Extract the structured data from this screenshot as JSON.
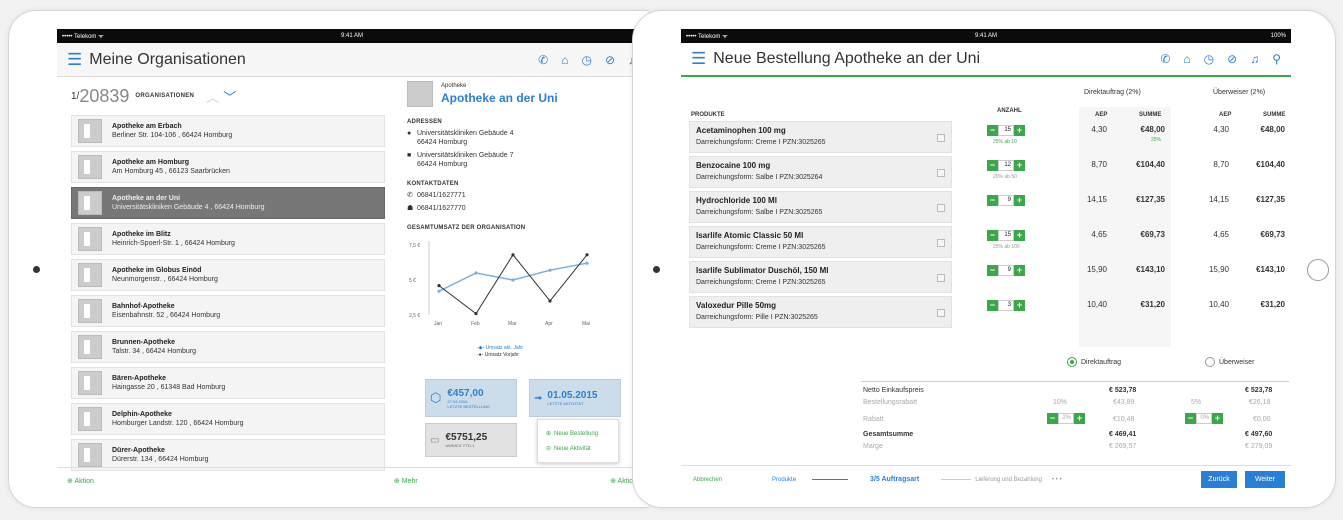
{
  "left": {
    "status": {
      "carrier": "••••• Telekom ᯤ",
      "time": "9:41 AM"
    },
    "nav": {
      "menu_icon": "hamburger-icon",
      "title": "Meine Organisationen"
    },
    "org_header": {
      "count_prefix": "1/",
      "count": "20839",
      "label": "ORGANISATIONEN"
    },
    "organisations": [
      {
        "name": "Apotheke am Erbach",
        "address": "Berliner Str. 104-106 , 66424 Homburg"
      },
      {
        "name": "Apotheke am Homburg",
        "address": "Am Homburg 45 , 66123 Saarbrücken"
      },
      {
        "name": "Apotheke an der Uni",
        "address": "Universitätskliniken Gebäude 4 , 66424 Homburg"
      },
      {
        "name": "Apotheke im Blitz",
        "address": "Heinrich-Spoerl-Str. 1 , 66424 Homburg"
      },
      {
        "name": "Apotheke im Globus Einöd",
        "address": "Neunmorgenstr. , 66424 Homburg"
      },
      {
        "name": "Bahnhof-Apotheke",
        "address": "Eisenbahnstr. 52 , 66424 Homburg"
      },
      {
        "name": "Brunnen-Apotheke",
        "address": "Talstr. 34 , 66424 Homburg"
      },
      {
        "name": "Bären-Apotheke",
        "address": "Haingasse 20 , 61348 Bad Homburg"
      },
      {
        "name": "Delphin-Apotheke",
        "address": "Homburger Landstr. 120 , 66424 Homburg"
      },
      {
        "name": "Dürer-Apotheke",
        "address": "Dürerstr. 134 , 66424 Homburg"
      }
    ],
    "detail": {
      "kind": "Apotheke",
      "name": "Apotheke an der Uni",
      "addresses_label": "ADRESSEN",
      "address1": "Universitätskliniken Gebäude 4",
      "address1b": "66424 Homburg",
      "address2": "Universitätskliniken Gebäude 7",
      "address2b": "66424 Homburg",
      "contact_label": "KONTAKTDATEN",
      "phone": "06841/1627771",
      "fax": "06841/1627770",
      "revenue_label": "GESAMTUMSATZ DER ORGANISATION"
    },
    "tiles": {
      "t1_value": "€457,00",
      "t1_date": "27.04.2015",
      "t1_label": "LETZTE BESTELLUNG",
      "t2_value": "01.05.2015",
      "t2_label": "LETZTE AKTIVITÄT",
      "t3_value": "€5751,25",
      "t3_label": "UMSATZ YTD-1"
    },
    "popup": {
      "item1": "Neue Bestellung",
      "item2": "Neue Aktivität"
    },
    "footer": {
      "action": "Aktion",
      "more": "Mehr",
      "action2": "Aktion"
    }
  },
  "chart_data": {
    "type": "line",
    "categories": [
      "Jan",
      "Feb",
      "Mar",
      "Apr",
      "Mai"
    ],
    "series": [
      {
        "name": "Umsatz akt. Jahr",
        "values": [
          4.2,
          5.5,
          5.0,
          5.7,
          6.2
        ],
        "color": "#7aaee0"
      },
      {
        "name": "Umsatz Vorjahr",
        "values": [
          4.6,
          2.6,
          6.8,
          3.5,
          6.8
        ],
        "color": "#333333"
      }
    ],
    "yticks": [
      "7,5 €",
      "5 €",
      "2,5 €"
    ],
    "ylim": [
      2.5,
      7.5
    ]
  },
  "right": {
    "status": {
      "carrier": "••••• Telekom ᯤ",
      "time": "9:41 AM",
      "battery": "100%"
    },
    "nav": {
      "menu_icon": "hamburger-icon",
      "title": "Neue Bestellung Apotheke an der Uni"
    },
    "headers": {
      "direct": "Direktauftrag (2%)",
      "transfer": "Überweiser (2%)",
      "products": "PRODUKTE",
      "qty": "ANZAHL",
      "aep": "AEP",
      "sum": "SUMME"
    },
    "products": [
      {
        "name": "Acetaminophen 100 mg",
        "desc": "Darreichungsform: Creme I PZN:3025265",
        "qty": "15",
        "note": "25% ab 10",
        "aep": "4,30",
        "sum": "€48,00",
        "sum_note": "25%",
        "aep2": "4,30",
        "sum2": "€48,00"
      },
      {
        "name": "Benzocaine 100 mg",
        "desc": "Darreichungsform: Salbe I PZN:3025264",
        "qty": "12",
        "note": "20% ab 50",
        "aep": "8,70",
        "sum": "€104,40",
        "sum_note": "",
        "aep2": "8,70",
        "sum2": "€104,40"
      },
      {
        "name": "Hydrochloride 100 Ml",
        "desc": "Darreichungsform: Salbe I PZN:3025265",
        "qty": "9",
        "note": "",
        "aep": "14,15",
        "sum": "€127,35",
        "sum_note": "",
        "aep2": "14,15",
        "sum2": "€127,35"
      },
      {
        "name": "Isarlife Atomic Classic 50 Ml",
        "desc": "Darreichungsform: Creme I PZN:3025265",
        "qty": "15",
        "note": "25% ab 100",
        "aep": "4,65",
        "sum": "€69,73",
        "sum_note": "",
        "aep2": "4,65",
        "sum2": "€69,73"
      },
      {
        "name": "Isarlife Sublimator Duschöl, 150 Ml",
        "desc": "Darreichungsform: Creme I PZN:3025265",
        "qty": "9",
        "note": "",
        "aep": "15,90",
        "sum": "€143,10",
        "sum_note": "",
        "aep2": "15,90",
        "sum2": "€143,10"
      },
      {
        "name": "Valoxedur Pille 50mg",
        "desc": "Darreichungsform: Pille I PZN:3025265",
        "qty": "3",
        "note": "",
        "aep": "10,40",
        "sum": "€31,20",
        "sum_note": "",
        "aep2": "10,40",
        "sum2": "€31,20"
      }
    ],
    "radio": {
      "direct": "Direktauftrag",
      "transfer": "Überweiser"
    },
    "totals": {
      "net_label": "Netto Einkaufspreis",
      "net1": "€ 523,78",
      "net2": "€ 523,78",
      "discount_label": "Bestellungsrabatt",
      "disc_pct1": "10%",
      "disc1": "€43,89",
      "disc_pct2": "5%",
      "disc2": "€26,18",
      "rabatt_label": "Rabatt",
      "rabatt_pct1": "2%",
      "rabatt1": "€10,48",
      "rabatt_pct2": "0%",
      "rabatt2": "€0,00",
      "total_label": "Gesamtsumme",
      "total1": "€ 469,41",
      "total2": "€ 497,60",
      "margin_label": "Marge",
      "margin1": "€ 269,57",
      "margin2": "€ 279,09"
    },
    "footer": {
      "cancel": "Abbrechen",
      "products": "Produkte",
      "step": "3/5 Auftragsart",
      "next_step": "Lieferung und Bezahlung",
      "dots": "• • •",
      "back": "Zurück",
      "next": "Weiter"
    }
  }
}
